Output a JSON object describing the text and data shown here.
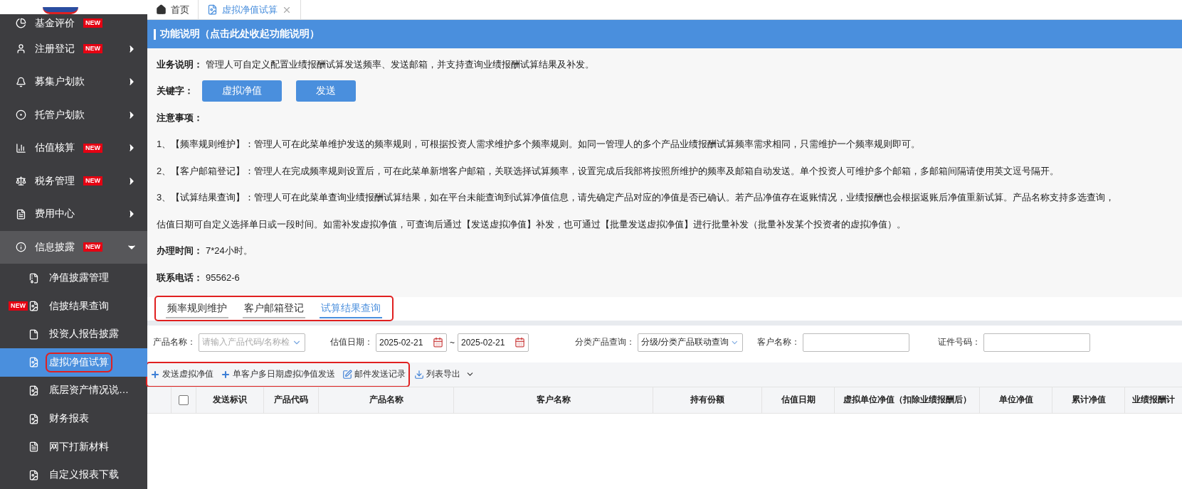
{
  "sidebar": {
    "items": [
      {
        "label": "基金评价",
        "badge": "NEW",
        "has_submenu": false,
        "expanded": false
      },
      {
        "label": "注册登记",
        "badge": "NEW",
        "has_submenu": true,
        "expanded": false
      },
      {
        "label": "募集户划款",
        "has_submenu": true,
        "expanded": false
      },
      {
        "label": "托管户划款",
        "has_submenu": true,
        "expanded": false
      },
      {
        "label": "估值核算",
        "badge": "NEW",
        "has_submenu": true,
        "expanded": false
      },
      {
        "label": "税务管理",
        "badge": "NEW",
        "has_submenu": true,
        "expanded": false
      },
      {
        "label": "费用中心",
        "has_submenu": true,
        "expanded": false
      },
      {
        "label": "信息披露",
        "badge": "NEW",
        "has_submenu": true,
        "expanded": true,
        "children": [
          {
            "label": "净值披露管理",
            "selected": false
          },
          {
            "label": "信披结果查询",
            "badge": "NEW",
            "selected": false
          },
          {
            "label": "投资人报告披露",
            "selected": false
          },
          {
            "label": "虚拟净值试算",
            "selected": true,
            "highlighted": true
          },
          {
            "label": "底层资产情况说…",
            "selected": false
          },
          {
            "label": "财务报表",
            "selected": false
          },
          {
            "label": "网下打新材料",
            "selected": false
          },
          {
            "label": "自定义报表下载",
            "selected": false
          }
        ]
      }
    ]
  },
  "page_tabs": [
    {
      "label": "首页",
      "selected": false,
      "closable": false
    },
    {
      "label": "虚拟净值试算",
      "selected": true,
      "closable": true
    }
  ],
  "info_panel": {
    "title": "功能说明（点击此处收起功能说明）",
    "lines": [
      {
        "kind": "text",
        "label": "业务说明：",
        "text": "管理人可自定义配置业绩报酬试算发送频率、发送邮箱，并支持查询业绩报酬试算结果及补发。"
      },
      {
        "kind": "keywords",
        "label": "关键字：",
        "keywords": [
          "虚拟净值",
          "发送"
        ]
      },
      {
        "kind": "heading",
        "label": "注意事项："
      },
      {
        "kind": "text",
        "text": "1、【频率规则维护】：管理人可在此菜单维护发送的频率规则，可根据投资人需求维护多个频率规则。如同一管理人的多个产品业绩报酬试算频率需求相同，只需维护一个频率规则即可。"
      },
      {
        "kind": "text",
        "text": "2、【客户邮箱登记】：管理人在完成频率规则设置后，可在此菜单新增客户邮箱，关联选择试算频率，设置完成后我部将按照所维护的频率及邮箱自动发送。单个投资人可维护多个邮箱，多邮箱间隔请使用英文逗号隔开。"
      },
      {
        "kind": "text",
        "text": "3、【试算结果查询】：管理人可在此菜单查询业绩报酬试算结果，如在平台未能查询到试算净值信息，请先确定产品对应的净值是否已确认。若产品净值存在返账情况，业绩报酬也会根据返账后净值重新试算。产品名称支持多选查询，"
      },
      {
        "kind": "text",
        "text": "估值日期可自定义选择单日或一段时间。如需补发虚拟净值，可查询后通过【发送虚拟净值】补发，也可通过【批量发送虚拟净值】进行批量补发（批量补发某个投资者的虚拟净值）。"
      },
      {
        "kind": "text",
        "label": "办理时间：",
        "text": "7*24小时。"
      },
      {
        "kind": "text",
        "label": "联系电话：",
        "text": "95562-6"
      }
    ]
  },
  "sub_tabs": {
    "highlighted": true,
    "items": [
      {
        "label": "频率规则维护",
        "selected": false
      },
      {
        "label": "客户邮箱登记",
        "selected": false
      },
      {
        "label": "试算结果查询",
        "selected": true
      }
    ]
  },
  "filters": [
    {
      "kind": "select",
      "label": "产品名称：",
      "placeholder": "请输入产品代码/名称检"
    },
    {
      "kind": "daterange",
      "label": "估值日期：",
      "from": "2025-02-21",
      "separator": "~",
      "to": "2025-02-21"
    },
    {
      "kind": "select",
      "label": "分类产品查询：",
      "value": "分级/分类产品联动查询"
    },
    {
      "kind": "input",
      "label": "客户名称："
    },
    {
      "kind": "input",
      "label": "证件号码："
    }
  ],
  "toolbar": {
    "actions": [
      {
        "kind": "add",
        "label": "发送虚拟净值",
        "highlighted": true
      },
      {
        "kind": "add",
        "label": "单客户多日期虚拟净值发送",
        "highlighted": true
      },
      {
        "kind": "edit",
        "label": "邮件发送记录",
        "highlighted": true
      },
      {
        "kind": "export",
        "label": "列表导出",
        "has_menu": true
      }
    ]
  },
  "table": {
    "select_all_checked": false,
    "columns": [
      "发送标识",
      "产品代码",
      "产品名称",
      "客户名称",
      "持有份额",
      "估值日期",
      "虚拟单位净值（扣除业绩报酬后）",
      "单位净值",
      "累计净值",
      "业绩报酬计"
    ]
  }
}
